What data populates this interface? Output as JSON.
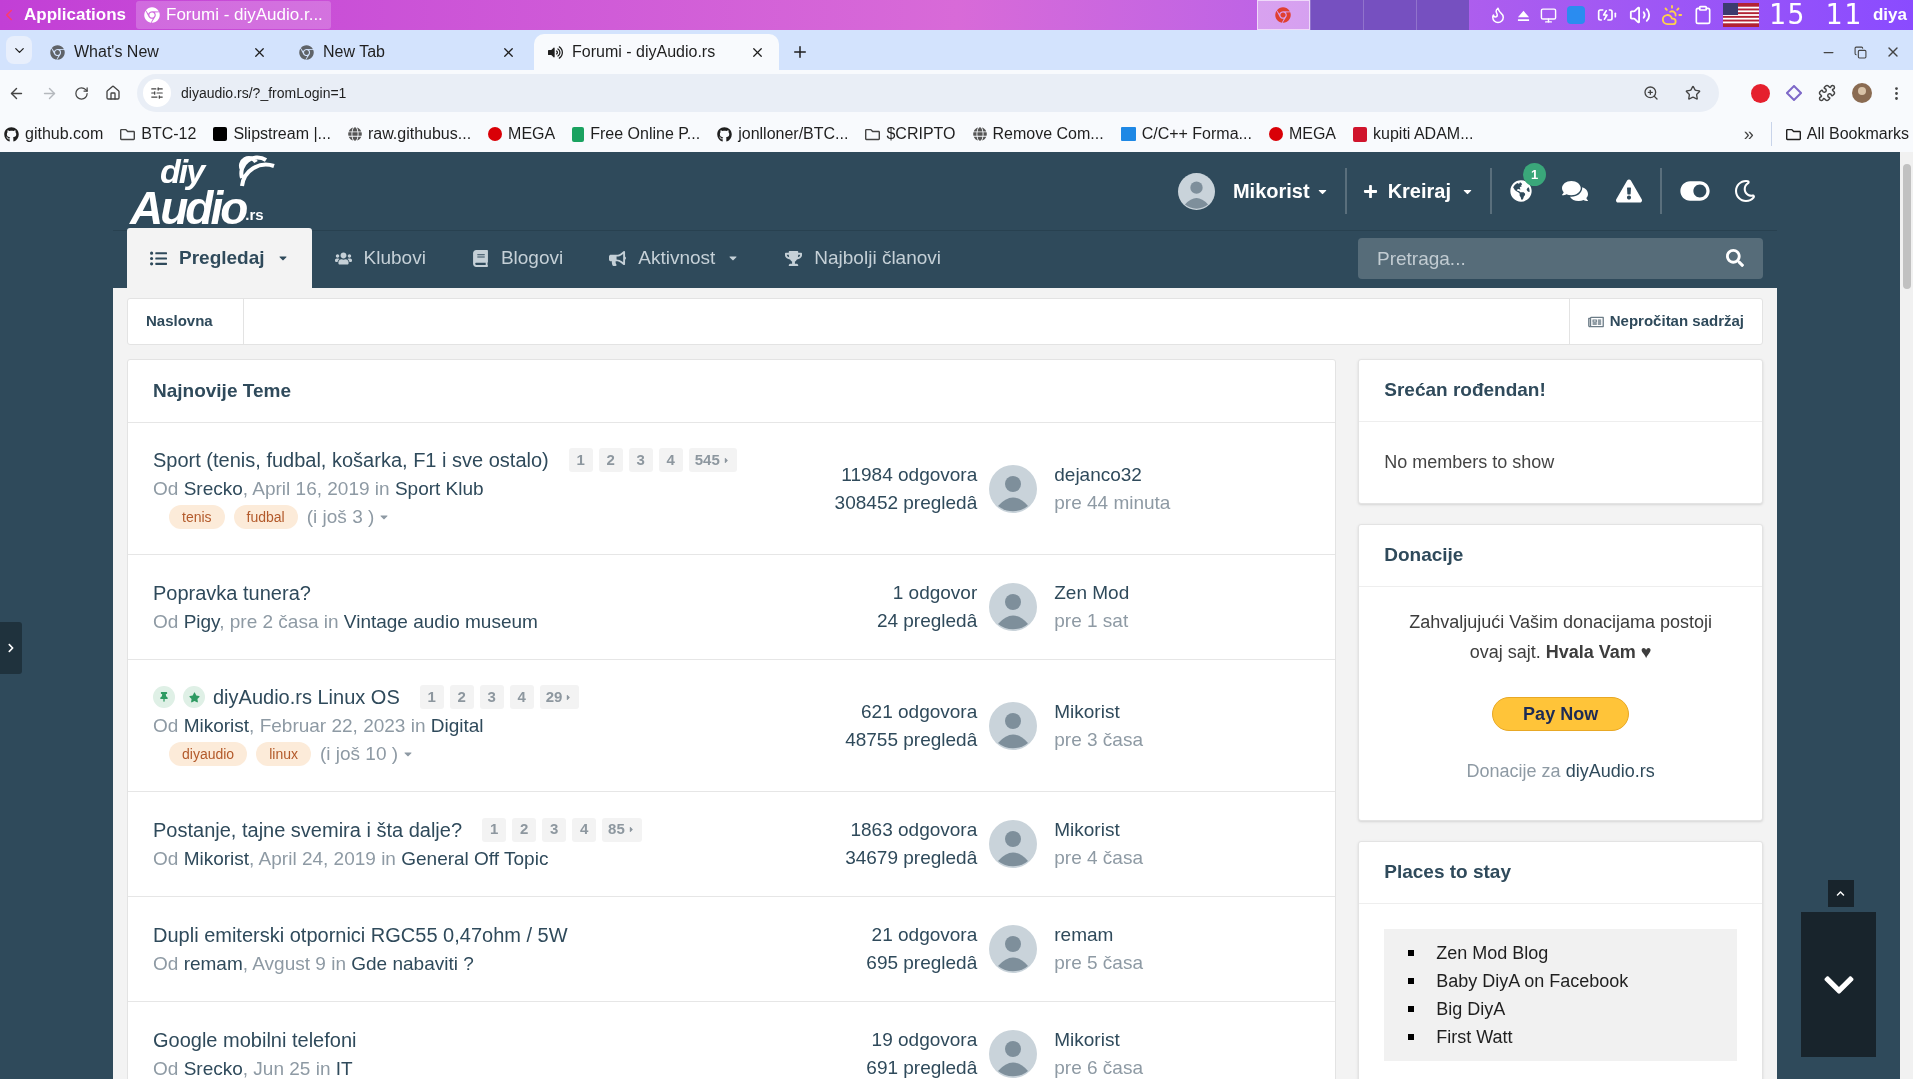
{
  "taskbar": {
    "launcher": "Applications",
    "window_button": "Forumi - diyAudio.r...",
    "workspaces": [
      {
        "selected": true
      },
      {
        "selected": false
      },
      {
        "selected": false
      },
      {
        "selected": false
      }
    ],
    "clock": "15 11",
    "user": "diya"
  },
  "browser_tabs": [
    {
      "title": "What's New",
      "selected": false,
      "playing_audio": false
    },
    {
      "title": "New Tab",
      "selected": false,
      "playing_audio": false
    },
    {
      "title": "Forumi - diyAudio.rs",
      "selected": true,
      "playing_audio": true
    }
  ],
  "toolbar": {
    "url": "diyaudio.rs/?_fromLogin=1",
    "forward_disabled": true
  },
  "bookmarks": [
    {
      "label": "github.com",
      "kind": "github"
    },
    {
      "label": "BTC-12",
      "kind": "folder"
    },
    {
      "label": "Slipstream |...",
      "kind": "m"
    },
    {
      "label": "raw.githubus...",
      "kind": "globe"
    },
    {
      "label": "MEGA",
      "kind": "mega"
    },
    {
      "label": "Free Online P...",
      "kind": "doc"
    },
    {
      "label": "jonlloner/BTC...",
      "kind": "github"
    },
    {
      "label": "$CRIPTO",
      "kind": "folder"
    },
    {
      "label": "Remove Com...",
      "kind": "globe"
    },
    {
      "label": "C/C++ Forma...",
      "kind": "fmt"
    },
    {
      "label": "MEGA",
      "kind": "mega"
    },
    {
      "label": "kupiti ADAM...",
      "kind": "music"
    }
  ],
  "bookmarks_more": "»",
  "all_bookmarks": "All Bookmarks",
  "site": {
    "logo": {
      "top": "diy",
      "main": "Audio",
      "suffix": ".rs"
    },
    "user_menu": "Mikorist",
    "create_menu": "Kreiraj",
    "notification_count": "1",
    "nav": [
      {
        "label": "Pregledaj",
        "selected": true,
        "dropdown": true,
        "kind": "list"
      },
      {
        "label": "Klubovi",
        "selected": false,
        "dropdown": false,
        "kind": "users"
      },
      {
        "label": "Blogovi",
        "selected": false,
        "dropdown": false,
        "kind": "book"
      },
      {
        "label": "Aktivnost",
        "selected": false,
        "dropdown": true,
        "kind": "bullhorn"
      },
      {
        "label": "Najbolji članovi",
        "selected": false,
        "dropdown": false,
        "kind": "trophy"
      }
    ],
    "search": {
      "placeholder": "Pretraga..."
    },
    "breadcrumb": "Naslovna",
    "unread": "Nepročitan sadržaj"
  },
  "topics_panel": {
    "title": "Najnovije Teme",
    "topics": [
      {
        "title": "Sport (tenis, fudbal, košarka, F1 i sve ostalo)",
        "pages": [
          "1",
          "2",
          "3",
          "4",
          "545"
        ],
        "by": "Od",
        "author": "Srecko",
        "date": ", April 16, 2019",
        "in": "in",
        "forum": "Sport Klub",
        "tags": [
          "tenis",
          "fudbal"
        ],
        "more_tags": "(i još 3 )",
        "replies": "11984 odgovora",
        "views": "308452 pregledâ",
        "last_user": "dejanco32",
        "last_time": "pre 44 minuta"
      },
      {
        "title": "Popravka tunera?",
        "by": "Od",
        "author": "Pigy",
        "date": ", pre 2 časa",
        "in": "in",
        "forum": "Vintage audio museum",
        "replies": "1 odgovor",
        "views": "24 pregledâ",
        "last_user": "Zen Mod",
        "last_time": "pre 1 sat"
      },
      {
        "title": "diyAudio.rs Linux OS",
        "pinned": true,
        "featured": true,
        "pages": [
          "1",
          "2",
          "3",
          "4",
          "29"
        ],
        "by": "Od",
        "author": "Mikorist",
        "date": ", Februar 22, 2023",
        "in": "in",
        "forum": "Digital",
        "tags": [
          "diyaudio",
          "linux"
        ],
        "more_tags": "(i još 10 )",
        "replies": "621 odgovora",
        "views": "48755 pregledâ",
        "last_user": "Mikorist",
        "last_time": "pre 3 časa"
      },
      {
        "title": "Postanje, tajne svemira i šta dalje?",
        "pages": [
          "1",
          "2",
          "3",
          "4",
          "85"
        ],
        "by": "Od",
        "author": "Mikorist",
        "date": ", April 24, 2019",
        "in": "in",
        "forum": "General Off Topic",
        "replies": "1863 odgovora",
        "views": "34679 pregledâ",
        "last_user": "Mikorist",
        "last_time": "pre 4 časa"
      },
      {
        "title": "Dupli emiterski otpornici RGC55 0,47ohm / 5W",
        "by": "Od",
        "author": "remam",
        "date": ", Avgust 9",
        "in": "in",
        "forum": "Gde nabaviti ?",
        "replies": "21 odgovora",
        "views": "695 pregledâ",
        "last_user": "remam",
        "last_time": "pre 5 časa"
      },
      {
        "title": "Google mobilni telefoni",
        "by": "Od",
        "author": "Srecko",
        "date": ", Jun 25",
        "in": "in",
        "forum": "IT",
        "replies": "19 odgovora",
        "views": "691 pregledâ",
        "last_user": "Mikorist",
        "last_time": "pre 6 časa"
      }
    ]
  },
  "sidebar": {
    "birthday": {
      "title": "Srećan rođendan!",
      "text": "No members to show"
    },
    "donations": {
      "title": "Donacije",
      "text": "Zahvaljujući Vašim donacijama postoji ovaj sajt. **Hvala Vam ♥**",
      "button": "Pay Now",
      "footer": "Donacije za",
      "footer_link": "diyAudio.rs"
    },
    "places": {
      "title": "Places to stay",
      "items": [
        "Zen Mod Blog",
        "Baby DiyA on Facebook",
        "Big DiyA",
        "First Watt"
      ]
    }
  }
}
